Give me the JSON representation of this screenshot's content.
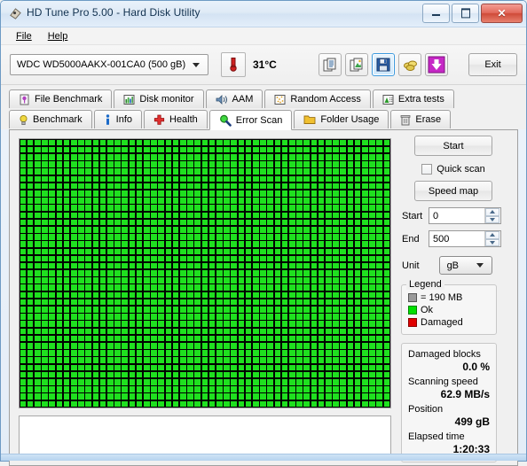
{
  "window": {
    "title": "HD Tune Pro 5.00 - Hard Disk Utility",
    "icon": "hdtune-app-icon",
    "minimize_label": "Minimize",
    "maximize_label": "Maximize",
    "close_label": "Close"
  },
  "menu": {
    "items": [
      {
        "label": "File",
        "accel": "F"
      },
      {
        "label": "Help",
        "accel": "H"
      }
    ]
  },
  "toolbar": {
    "drive": "WDC WD5000AAKX-001CA0 (500 gB)",
    "temperature": "31°C",
    "thermometer_icon": "thermometer-icon",
    "buttons": [
      {
        "name": "copy-text-icon",
        "title": "Copy to clipboard (text)",
        "active": false
      },
      {
        "name": "copy-image-icon",
        "title": "Copy to clipboard (image)",
        "active": false
      },
      {
        "name": "save-icon",
        "title": "Save",
        "active": true
      },
      {
        "name": "donate-icon",
        "title": "Donate",
        "active": false
      },
      {
        "name": "download-icon",
        "title": "Download",
        "active": false
      }
    ],
    "exit_label": "Exit"
  },
  "tabs": {
    "row1": [
      {
        "label": "File Benchmark",
        "icon": "file-benchmark-icon",
        "active": false
      },
      {
        "label": "Disk monitor",
        "icon": "disk-monitor-icon",
        "active": false
      },
      {
        "label": "AAM",
        "icon": "aam-speaker-icon",
        "active": false
      },
      {
        "label": "Random Access",
        "icon": "random-access-icon",
        "active": false
      },
      {
        "label": "Extra tests",
        "icon": "extra-tests-icon",
        "active": false
      }
    ],
    "row2": [
      {
        "label": "Benchmark",
        "icon": "benchmark-bulb-icon",
        "active": false
      },
      {
        "label": "Info",
        "icon": "info-icon",
        "active": false
      },
      {
        "label": "Health",
        "icon": "health-cross-icon",
        "active": false
      },
      {
        "label": "Error Scan",
        "icon": "error-scan-magnifier-icon",
        "active": true
      },
      {
        "label": "Folder Usage",
        "icon": "folder-usage-icon",
        "active": false
      },
      {
        "label": "Erase",
        "icon": "erase-trash-icon",
        "active": false
      }
    ]
  },
  "error_scan": {
    "start_button": "Start",
    "quick_scan_label": "Quick scan",
    "quick_scan_checked": false,
    "speed_map_button": "Speed map",
    "start_label": "Start",
    "start_value": "0",
    "end_label": "End",
    "end_value": "500",
    "unit_label": "Unit",
    "unit_value": "gB",
    "legend": {
      "title": "Legend",
      "block_size": "= 190 MB",
      "ok_label": "Ok",
      "damaged_label": "Damaged",
      "ok_color": "#00e000",
      "damaged_color": "#e00000",
      "block_color": "#9a9a9a"
    },
    "stats": [
      {
        "label": "Damaged blocks",
        "value": "0.0 %"
      },
      {
        "label": "Scanning speed",
        "value": "62.9 MB/s"
      },
      {
        "label": "Position",
        "value": "499 gB"
      },
      {
        "label": "Elapsed time",
        "value": "1:20:33"
      }
    ],
    "map": {
      "columns": 51,
      "rows": 37,
      "filled_color": "#1fe01f",
      "grid_color": "#000000",
      "progress_percent": 100
    },
    "log_text": ""
  }
}
